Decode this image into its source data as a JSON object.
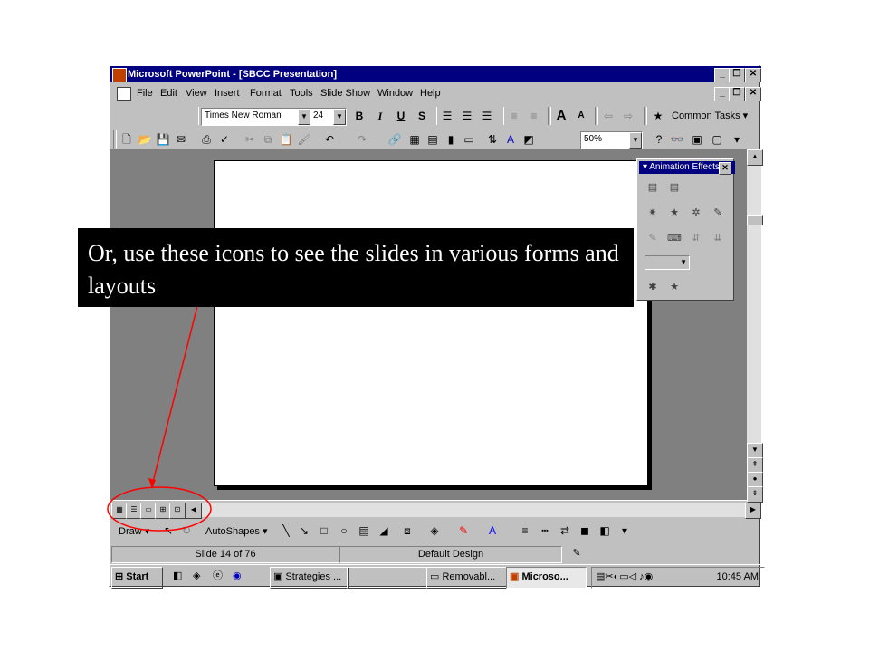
{
  "window": {
    "title": "Microsoft PowerPoint - [SBCC Presentation]",
    "title_buttons": [
      "_",
      "❐",
      "✕"
    ]
  },
  "menu": {
    "items": [
      "File",
      "Edit",
      "View",
      "Insert",
      "Format",
      "Tools",
      "Slide Show",
      "Window",
      "Help"
    ]
  },
  "formatting_toolbar": {
    "font": "Times New Roman",
    "font_size": "24",
    "bold": "B",
    "italic": "I",
    "underline": "U",
    "shadow": "S",
    "common_tasks": "Common Tasks"
  },
  "standard_toolbar": {
    "zoom": "50%"
  },
  "animation_panel": {
    "title": "Animation Effects"
  },
  "callout": {
    "text": "Or, use these icons to see the slides in various forms and layouts"
  },
  "drawing_toolbar": {
    "draw": "Draw",
    "autoshapes": "AutoShapes"
  },
  "status_bar": {
    "slide": "Slide 14 of 76",
    "design": "Default Design"
  },
  "taskbar": {
    "start": "Start",
    "tasks": [
      "Strategies ...",
      "",
      "Removabl...",
      "Microso..."
    ],
    "clock": "10:45 AM"
  },
  "colors": {
    "title_bar": "#000080",
    "chrome": "#c0c0c0",
    "workspace": "#808080",
    "annotation": "#ff0000",
    "callout_bg": "#000000"
  }
}
